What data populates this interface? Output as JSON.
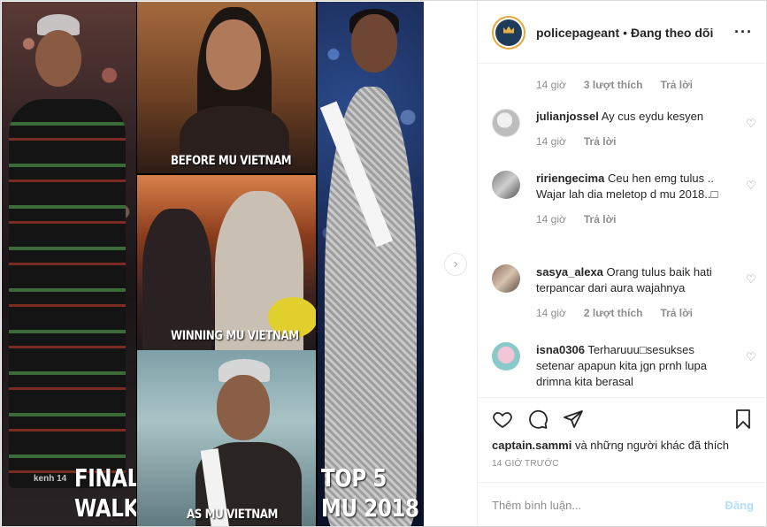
{
  "media": {
    "captions": {
      "final_line1": "FINAL",
      "final_line2": "WALK",
      "before": "BEFORE MU VIETNAM",
      "winning": "WINNING MU VIETNAM",
      "as_mu": "AS MU VIETNAM",
      "top5_line1": "TOP 5",
      "top5_line2": "MU 2018"
    },
    "watermark": "kenh 14",
    "next_icon": "chevron-right-icon"
  },
  "header": {
    "username": "policepageant",
    "separator": "•",
    "follow_status": "Đang theo dõi",
    "more_icon": "more-options-icon",
    "more_glyph": "···"
  },
  "comments": {
    "top_meta": {
      "time": "14 giờ",
      "likes": "3 lượt thích",
      "reply": "Trả lời"
    },
    "items": [
      {
        "username": "julianjossel",
        "text": "Ay cus eydu kesyen",
        "time": "14 giờ",
        "likes": "",
        "reply": "Trả lời"
      },
      {
        "username": "ririengecima",
        "text": "Ceu hen emg tulus .. Wajar lah dia meletop d mu 2018..□",
        "time": "14 giờ",
        "likes": "",
        "reply": "Trả lời"
      },
      {
        "username": "sasya_alexa",
        "text": "Orang tulus baik hati terpancar dari aura wajahnya",
        "time": "14 giờ",
        "likes": "2 lượt thích",
        "reply": "Trả lời"
      },
      {
        "username": "isna0306",
        "text": "Terharuuu□sesukses setenar apapun kita jgn prnh lupa drimna kita berasal",
        "time": "",
        "likes": "",
        "reply": ""
      }
    ]
  },
  "actions": {
    "like_icon": "heart-icon",
    "comment_icon": "comment-icon",
    "share_icon": "share-icon",
    "save_icon": "bookmark-icon",
    "likes_user": "captain.sammi",
    "likes_rest": " và những người khác đã thích",
    "timestamp": "14 GIỜ TRƯỚC"
  },
  "add_comment": {
    "placeholder": "Thêm bình luận...",
    "post_label": "Đăng"
  }
}
